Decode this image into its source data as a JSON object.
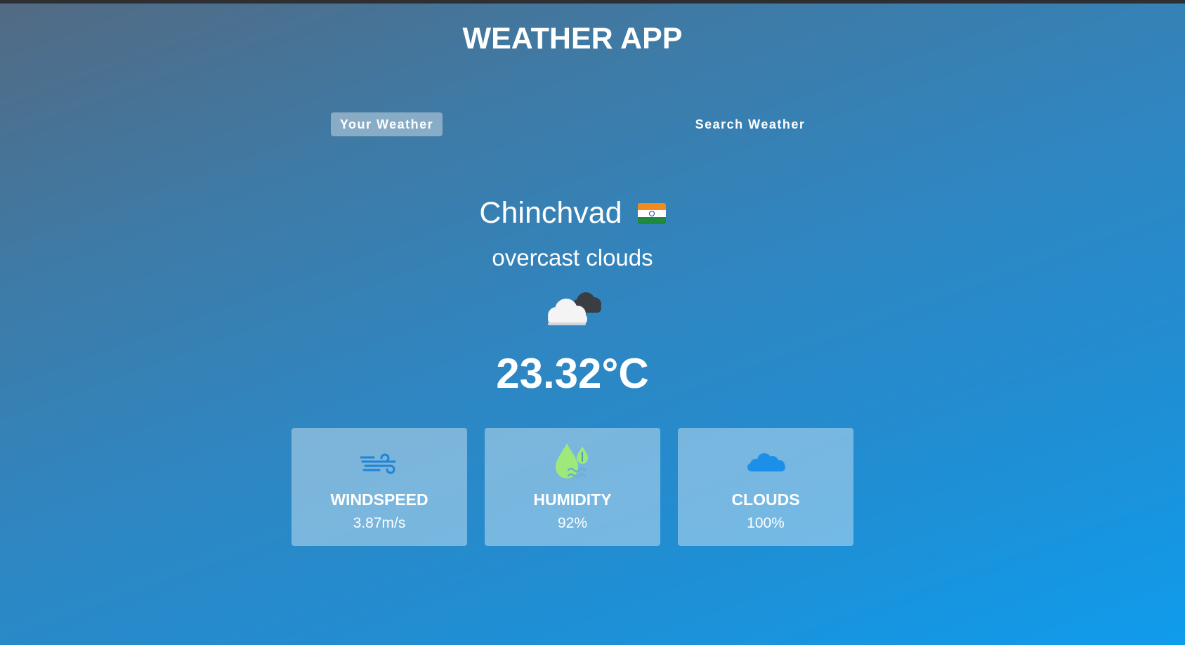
{
  "app": {
    "title": "WEATHER APP"
  },
  "tabs": [
    {
      "label": "Your Weather",
      "active": true
    },
    {
      "label": "Search Weather",
      "active": false
    }
  ],
  "weather": {
    "city": "Chinchvad",
    "country_flag": "india-flag-icon",
    "description": "overcast clouds",
    "icon": "overcast-clouds-icon",
    "temperature": "23.32°C"
  },
  "stats": {
    "windspeed": {
      "label": "WINDSPEED",
      "value": "3.87m/s",
      "icon": "wind-icon"
    },
    "humidity": {
      "label": "HUMIDITY",
      "value": "92%",
      "icon": "humidity-drops-icon"
    },
    "clouds": {
      "label": "CLOUDS",
      "value": "100%",
      "icon": "cloud-icon"
    }
  },
  "colors": {
    "background_start": "#526a83",
    "background_end": "#0f9cec",
    "card_overlay": "rgba(255,255,255,0.38)",
    "text": "#ffffff"
  }
}
